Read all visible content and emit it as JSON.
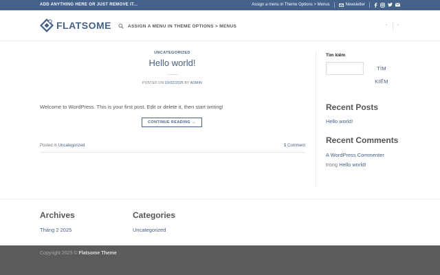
{
  "topbar": {
    "left_text": "ADD ANYTHING HERE OR JUST REMOVE IT...",
    "menu_hint": "Assign a menu in Theme Options > Menus",
    "newsletter": "Newsletter",
    "social_icons": [
      "facebook-icon",
      "instagram-icon",
      "twitter-icon",
      "email-icon"
    ],
    "bg_color": "#44628a"
  },
  "header": {
    "logo_text": "FLATSOME",
    "nav_hint": "ASSIGN A MENU IN THEME OPTIONS > MENUS",
    "right_items": [
      "-",
      "-"
    ]
  },
  "post": {
    "category": "UNCATEGORIZED",
    "title": "Hello world!",
    "meta_prefix": "POSTED ON",
    "date": "03/02/2025",
    "meta_by": "BY",
    "author": "ADMIN",
    "excerpt": "Welcome to WordPress. This is your first post. Edit or delete it, then start writing!",
    "continue_label": "CONTINUE READING →",
    "posted_in": "Posted in",
    "posted_in_category": "Uncategorized",
    "comment_count": "1",
    "comment_label": "Comment"
  },
  "sidebar": {
    "search_label": "Tìm kiếm",
    "search_value": "",
    "search_button_line1": "TÌM",
    "search_button_line2": "KIẾM",
    "recent_posts_title": "Recent Posts",
    "recent_posts": [
      "Hello world!"
    ],
    "recent_comments_title": "Recent Comments",
    "comment_author": "A WordPress Commenter",
    "comment_on": "trong",
    "comment_post": "Hello world!"
  },
  "footer_widgets": {
    "archives_title": "Archives",
    "archives": [
      "Tháng 2 2025"
    ],
    "categories_title": "Categories",
    "categories": [
      "Uncategorized"
    ]
  },
  "bottom": {
    "copyright_prefix": "Copyright 2025 ©",
    "copyright_theme": "Flatsome Theme"
  },
  "colors": {
    "primary": "#446084",
    "bottom_bar": "#5b5b5b"
  }
}
